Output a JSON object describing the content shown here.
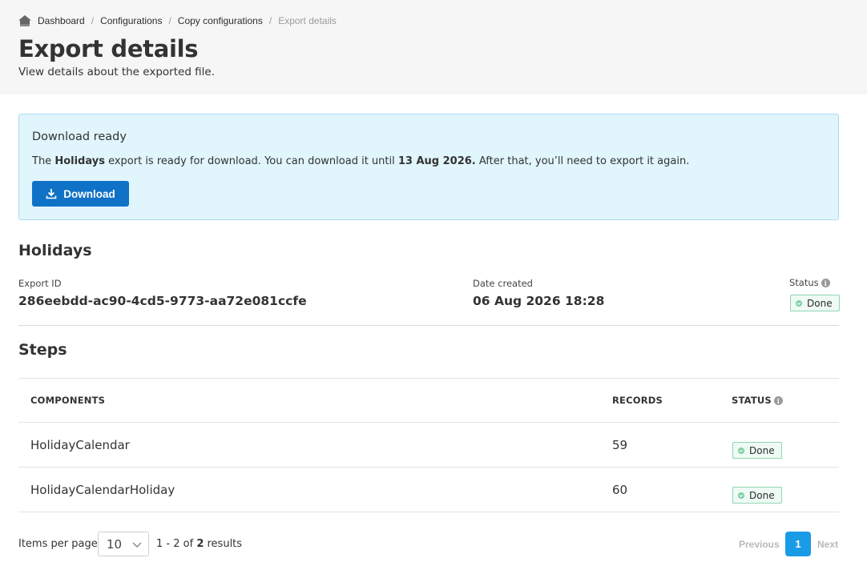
{
  "breadcrumb": {
    "items": [
      "Dashboard",
      "Configurations",
      "Copy configurations"
    ],
    "current": "Export details",
    "separator": "/"
  },
  "page": {
    "title": "Export details",
    "subtitle": "View details about the exported file."
  },
  "notice": {
    "title": "Download ready",
    "text_prefix": "The ",
    "export_name": "Holidays",
    "text_middle": " export is ready for download. You can download it until ",
    "expiry_date": "13 Aug 2026.",
    "text_suffix": " After that, you’ll need to export it again.",
    "download_label": "Download",
    "background_color": "#e1f5fd",
    "button_color": "#0f72c6"
  },
  "export": {
    "name": "Holidays",
    "id_label": "Export ID",
    "id_value": "286eebdd-ac90-4cd5-9773-aa72e081ccfe",
    "date_label": "Date created",
    "date_value": "06 Aug 2026 18:28",
    "status_label": "Status",
    "status_value": "Done"
  },
  "steps": {
    "title": "Steps",
    "columns": [
      "COMPONENTS",
      "RECORDS",
      "STATUS"
    ],
    "rows": [
      {
        "component": "HolidayCalendar",
        "records": "59",
        "status": "Done"
      },
      {
        "component": "HolidayCalendarHoliday",
        "records": "60",
        "status": "Done"
      }
    ]
  },
  "pagination": {
    "items_per_page_label": "Items per page",
    "items_per_page_value": "10",
    "range": "1 - 2",
    "of_label": "of",
    "total": "2",
    "results_label": "results",
    "previous_label": "Previous",
    "current_page": "1",
    "next_label": "Next",
    "accent_color": "#1a9be6"
  },
  "icons": {
    "home": "home-icon",
    "download": "download-icon",
    "info": "info-icon",
    "check": "check-circle-icon",
    "chevron": "chevron-down-icon"
  }
}
